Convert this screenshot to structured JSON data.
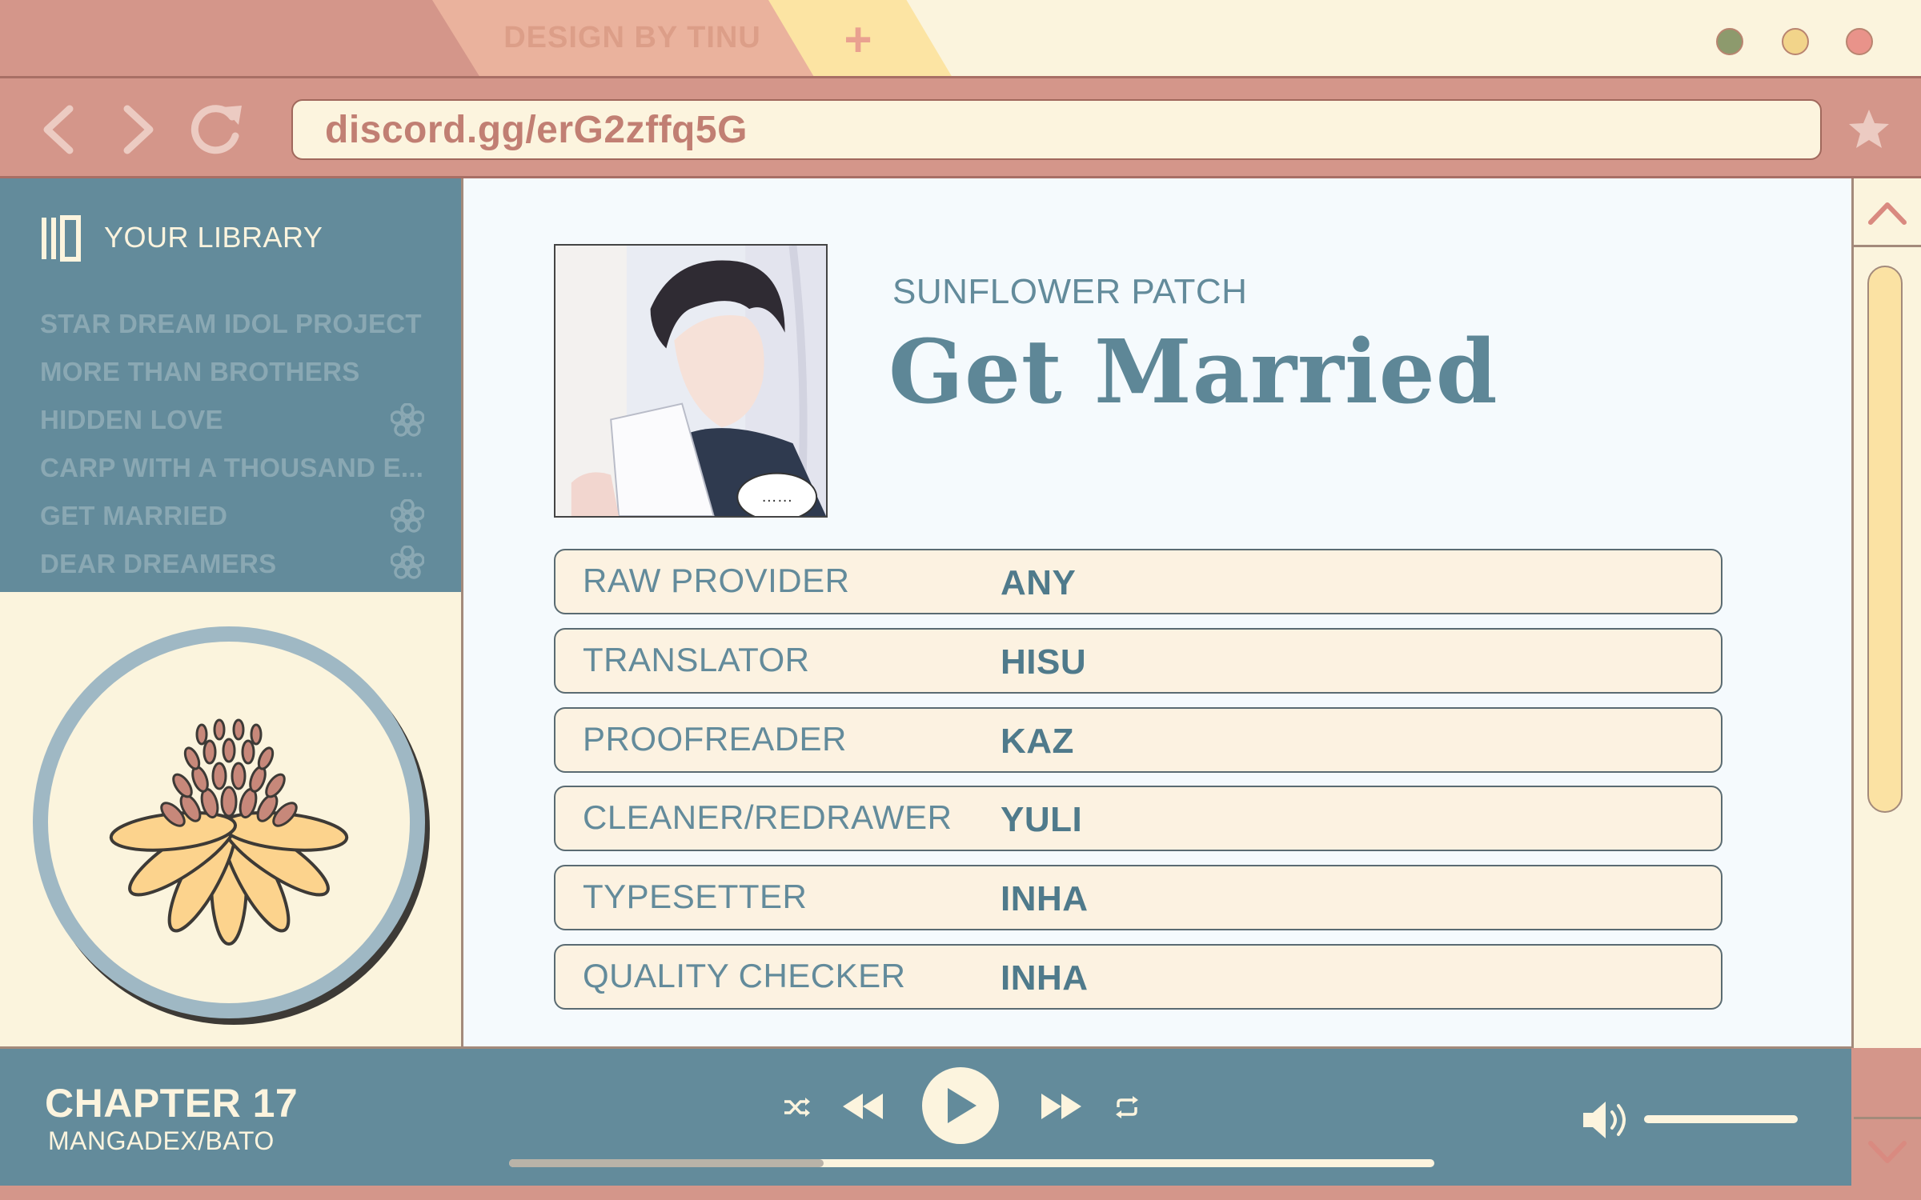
{
  "browser": {
    "tab_label": "DESIGN BY TINU",
    "new_tab_icon": "plus-icon",
    "window_dots": [
      "#8d9a6d",
      "#f2d48a",
      "#e9938a"
    ],
    "url": "discord.gg/erG2zffq5G"
  },
  "sidebar": {
    "title": "YOUR LIBRARY",
    "items": [
      {
        "label": "STAR DREAM IDOL PROJECT",
        "flower": false
      },
      {
        "label": "MORE THAN BROTHERS",
        "flower": false
      },
      {
        "label": "HIDDEN LOVE",
        "flower": true
      },
      {
        "label": "CARP WITH A THOUSAND E...",
        "flower": false
      },
      {
        "label": "GET MARRIED",
        "flower": true
      },
      {
        "label": "DEAR DREAMERS",
        "flower": true
      }
    ]
  },
  "main": {
    "studio": "SUNFLOWER PATCH",
    "title": "Get Married",
    "cover_bubble": "……",
    "credits": [
      {
        "role": "RAW PROVIDER",
        "name": "ANY"
      },
      {
        "role": "TRANSLATOR",
        "name": "HISU"
      },
      {
        "role": "PROOFREADER",
        "name": "KAZ"
      },
      {
        "role": "CLEANER/REDRAWER",
        "name": "YULI"
      },
      {
        "role": "TYPESETTER",
        "name": "INHA"
      },
      {
        "role": "QUALITY CHECKER",
        "name": "INHA"
      }
    ]
  },
  "player": {
    "chapter": "CHAPTER 17",
    "source": "MANGADEX/BATO",
    "progress": 0.34,
    "volume": 1.0
  },
  "colors": {
    "rose": "#d4968a",
    "teal": "#638b9b",
    "cream": "#fbf4dd",
    "yellow": "#fce4a3"
  }
}
